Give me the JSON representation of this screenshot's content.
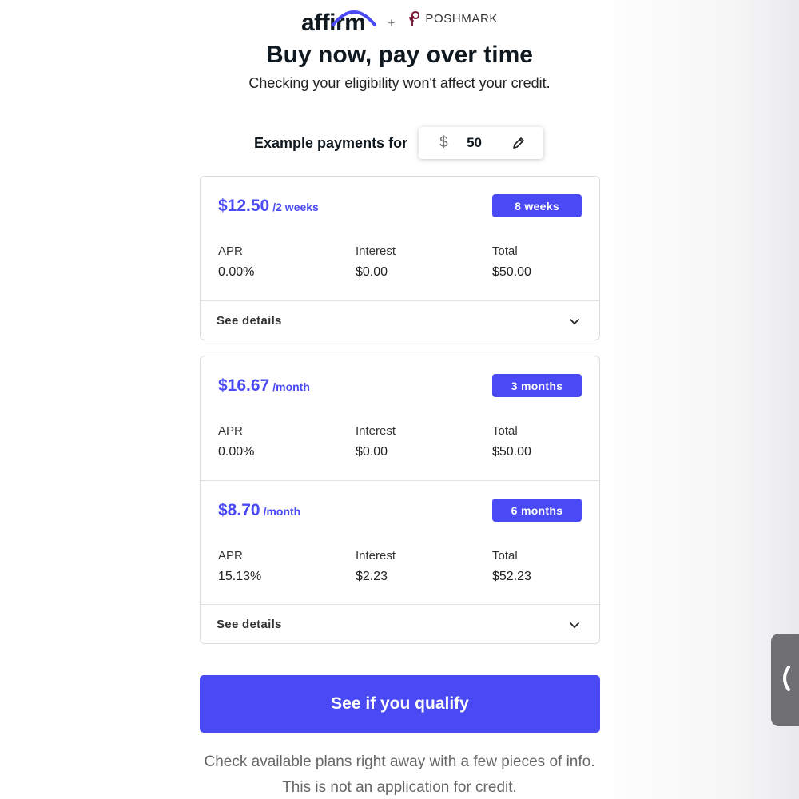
{
  "brand": {
    "affirm_wordmark": "affirm",
    "plus": "+",
    "partner_name": "POSHMARK"
  },
  "headline": "Buy now, pay over time",
  "subhead": "Checking your eligibility won't affect your credit.",
  "example": {
    "label": "Example payments for",
    "currency_symbol": "$",
    "amount": "50",
    "edit_icon": "pencil-icon"
  },
  "plans": [
    {
      "price": "$12.50",
      "per": "/2 weeks",
      "term": "8 weeks",
      "apr_label": "APR",
      "apr": "0.00%",
      "interest_label": "Interest",
      "interest": "$0.00",
      "total_label": "Total",
      "total": "$50.00"
    },
    {
      "price": "$16.67",
      "per": "/month",
      "term": "3 months",
      "apr_label": "APR",
      "apr": "0.00%",
      "interest_label": "Interest",
      "interest": "$0.00",
      "total_label": "Total",
      "total": "$50.00"
    },
    {
      "price": "$8.70",
      "per": "/month",
      "term": "6 months",
      "apr_label": "APR",
      "apr": "15.13%",
      "interest_label": "Interest",
      "interest": "$2.23",
      "total_label": "Total",
      "total": "$52.23"
    }
  ],
  "see_details": "See details",
  "cta_label": "See if you qualify",
  "footnote": {
    "line1": "Check available plans right away with a few pieces of info.",
    "line2": "This is not an application for credit."
  },
  "side_tab_icon": "chevron-left-icon",
  "colors": {
    "accent": "#4a4af4",
    "text": "#101820",
    "muted": "#666666"
  }
}
